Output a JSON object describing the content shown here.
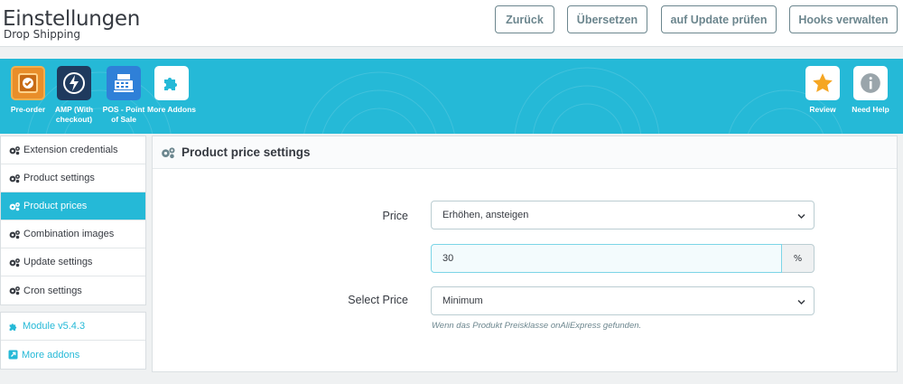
{
  "header": {
    "title": "Einstellungen",
    "subtitle": "Drop Shipping",
    "buttons": [
      "Zurück",
      "Übersetzen",
      "auf Update prüfen",
      "Hooks verwalten"
    ]
  },
  "banner": {
    "color": "#25b9d7",
    "addons_left": [
      {
        "label": "Pre-order",
        "icon": "clock-box-icon"
      },
      {
        "label": "AMP (With checkout)",
        "icon": "lightning-icon"
      },
      {
        "label": "POS - Point of Sale",
        "icon": "cash-register-icon"
      },
      {
        "label": "More Addons",
        "icon": "puzzle-icon"
      }
    ],
    "addons_right": [
      {
        "label": "Review",
        "icon": "star-icon"
      },
      {
        "label": "Need Help",
        "icon": "info-icon"
      }
    ]
  },
  "sidebar": {
    "items": [
      {
        "label": "Extension credentials",
        "active": false
      },
      {
        "label": "Product settings",
        "active": false
      },
      {
        "label": "Product prices",
        "active": true
      },
      {
        "label": "Combination images",
        "active": false
      },
      {
        "label": "Update settings",
        "active": false
      },
      {
        "label": "Cron settings",
        "active": false
      }
    ],
    "links": [
      {
        "label": "Module v5.4.3",
        "icon": "puzzle-icon"
      },
      {
        "label": "More addons",
        "icon": "external-link-icon"
      }
    ]
  },
  "panel": {
    "title": "Product price settings",
    "price_label": "Price",
    "price_value": "Erhöhen, ansteigen",
    "amount_value": "30",
    "amount_suffix": "%",
    "select_price_label": "Select Price",
    "select_price_value": "Minimum",
    "help_text": "Wenn das Produkt Preisklasse onAliExpress gefunden."
  }
}
